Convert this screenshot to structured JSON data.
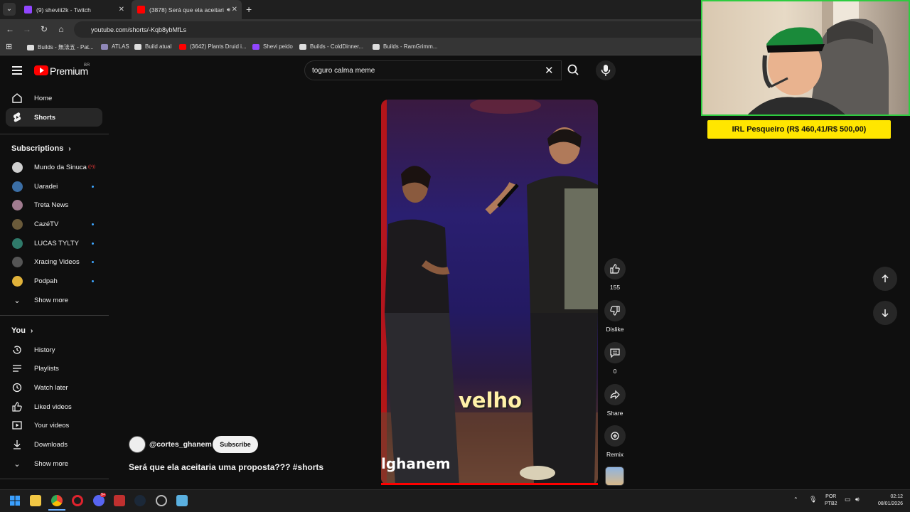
{
  "browser": {
    "tabs": [
      {
        "label": "(9) sheviii2k - Twitch",
        "close": "✕"
      },
      {
        "label": "(3878) Será que ela aceitari",
        "close": "✕"
      }
    ],
    "new_tab": "+",
    "url": "youtube.com/shorts/-Kqb8ybMfLs",
    "bookmarks": [
      "Builds - 無法五 - Pat...",
      "ATLAS",
      "Build atual",
      "(3642) Plants Druid i...",
      "Shevi peido",
      "Builds - ColdDinner...",
      "Builds - RamGrimm..."
    ]
  },
  "youtube": {
    "brand": "Premium",
    "region": "BR",
    "search_query": "toguro calma meme",
    "sidebar": {
      "main": [
        {
          "label": "Home",
          "icon": "home-icon"
        },
        {
          "label": "Shorts",
          "icon": "shorts-icon"
        }
      ],
      "subscriptions_title": "Subscriptions",
      "subscriptions": [
        {
          "label": "Mundo da Sinuca",
          "color": "#cfcfcf",
          "badge": "live"
        },
        {
          "label": "Uaradei",
          "color": "#3b6ea5",
          "badge": "dot"
        },
        {
          "label": "Treta News",
          "color": "#a07b8f",
          "badge": ""
        },
        {
          "label": "CazéTV",
          "color": "#6a5a3a",
          "badge": "dot"
        },
        {
          "label": "LUCAS TYLTY",
          "color": "#2f7a6a",
          "badge": "dot"
        },
        {
          "label": "Xracing Videos",
          "color": "#555555",
          "badge": "dot"
        },
        {
          "label": "Podpah",
          "color": "#e0b23a",
          "badge": "dot"
        }
      ],
      "show_more": "Show more",
      "you_title": "You",
      "you_items": [
        {
          "label": "History",
          "icon": "history-icon"
        },
        {
          "label": "Playlists",
          "icon": "playlists-icon"
        },
        {
          "label": "Watch later",
          "icon": "watch-later-icon"
        },
        {
          "label": "Liked videos",
          "icon": "liked-videos-icon"
        },
        {
          "label": "Your videos",
          "icon": "your-videos-icon"
        },
        {
          "label": "Downloads",
          "icon": "downloads-icon"
        }
      ],
      "show_more_2": "Show more"
    },
    "short": {
      "caption": "velho",
      "watermark": "lghanem",
      "channel": "@cortes_ghanem",
      "subscribe": "Subscribe",
      "title": "Será que ela aceitaria uma proposta??? #shorts",
      "likes": "155",
      "dislike": "Dislike",
      "comments": "0",
      "share": "Share",
      "remix": "Remix"
    }
  },
  "stream_overlay": {
    "goal": "IRL Pesqueiro (R$ 460,41/R$ 500,00)"
  },
  "taskbar": {
    "lang_1": "POR",
    "lang_2": "PTB2",
    "time": "02:12",
    "date": "08/01/2026",
    "discord_badge": "9+"
  },
  "colors": {
    "background": "#0f0f0f",
    "youtube_red": "#ff0000",
    "goal_yellow": "#ffe600",
    "webcam_border": "#2ecc40"
  }
}
